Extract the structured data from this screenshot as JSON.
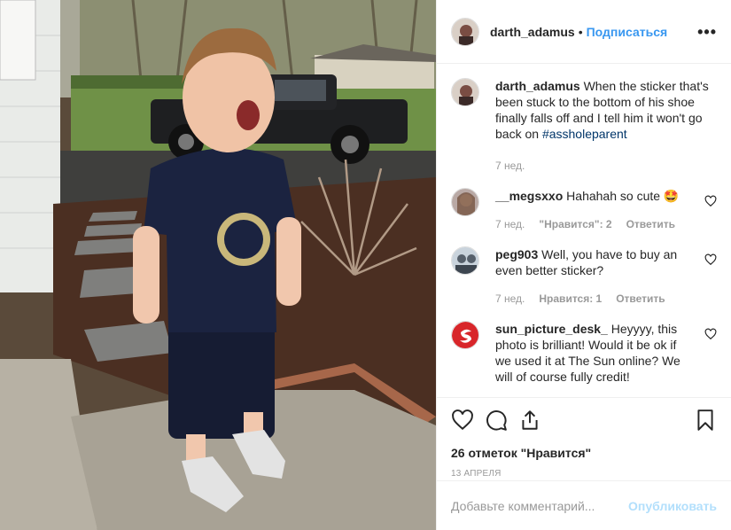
{
  "post": {
    "author": "darth_adamus",
    "separator": "•",
    "follow_label": "Подписаться",
    "more_label": "•••",
    "caption": {
      "user": "darth_adamus",
      "text": "When the sticker that's been stuck to the bottom of his shoe finally falls off and I tell him it won't go back on ",
      "hashtag": "#assholeparent",
      "time": "7 нед."
    },
    "comments": [
      {
        "user": "__megsxxo",
        "text": "Hahahah so cute 🤩",
        "time": "7 нед.",
        "likes": "\"Нравится\": 2",
        "reply": "Ответить"
      },
      {
        "user": "peg903",
        "text": "Well, you have to buy an even better sticker?",
        "time": "7 нед.",
        "likes": "Нравится: 1",
        "reply": "Ответить"
      },
      {
        "user": "sun_picture_desk_",
        "text": "Heyyyy, this photo is brilliant! Would it be ok if we used it at The Sun online? We will of course fully credit!"
      }
    ],
    "likes_count": "26 отметок \"Нравится\"",
    "date": "13 АПРЕЛЯ",
    "add_comment_placeholder": "Добавьте комментарий...",
    "publish_label": "Опубликовать"
  },
  "icons": [
    "heart-icon",
    "comment-icon",
    "share-icon",
    "bookmark-icon",
    "more-icon"
  ],
  "colors": {
    "link": "#3897f0",
    "hashtag": "#003569",
    "muted": "#999999",
    "publish_disabled": "#b2dffc"
  }
}
